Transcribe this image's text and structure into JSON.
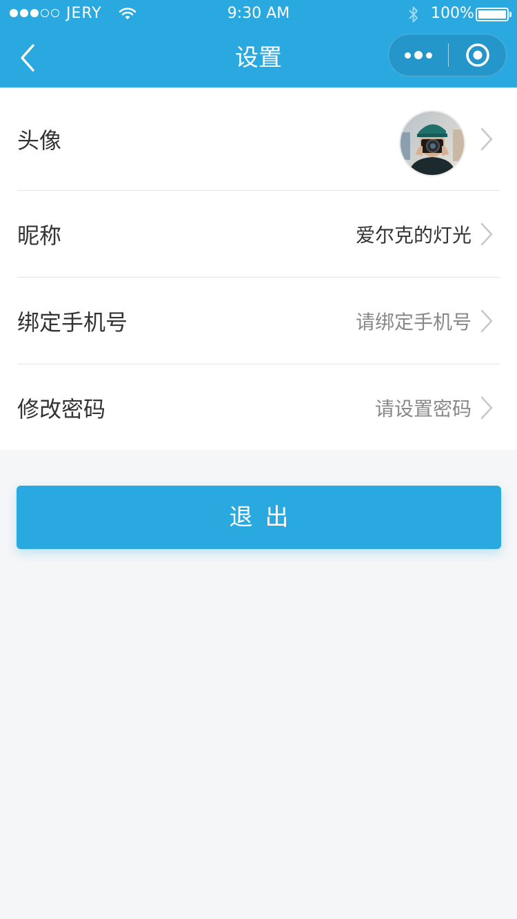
{
  "status_bar": {
    "carrier": "JERY",
    "time": "9:30 AM",
    "battery_pct": "100%",
    "signal_bars_filled": 3,
    "signal_bars_total": 5
  },
  "nav": {
    "title": "设置",
    "back_icon": "chevron-left-icon",
    "more_icon": "more-dots-icon",
    "close_icon": "target-close-icon"
  },
  "settings": {
    "avatar": {
      "label": "头像"
    },
    "nickname": {
      "label": "昵称",
      "value": "爱尔克的灯光"
    },
    "phone": {
      "label": "绑定手机号",
      "value": "请绑定手机号"
    },
    "password": {
      "label": "修改密码",
      "value": "请设置密码"
    }
  },
  "logout": {
    "label": "退出"
  },
  "colors": {
    "accent": "#2aa8e0",
    "background": "#f4f6f8",
    "text_primary": "#333333",
    "text_placeholder": "#888888"
  }
}
